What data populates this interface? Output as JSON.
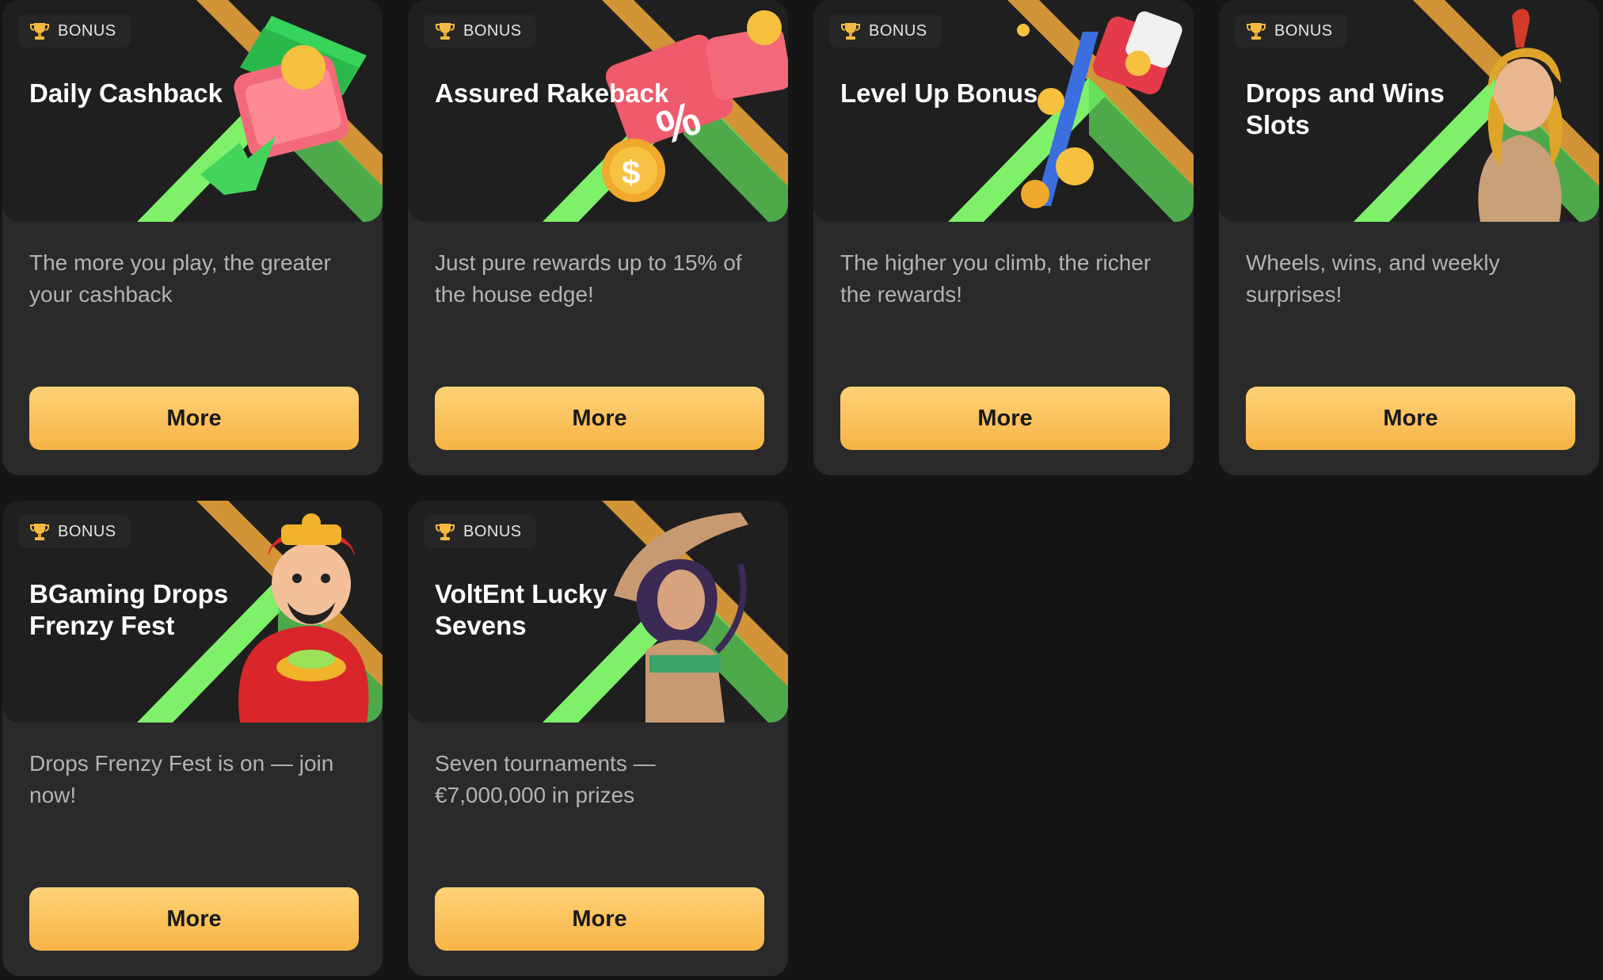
{
  "badge_label": "BONUS",
  "colors": {
    "page_bg": "#151515",
    "card_bg": "#2a2a2a",
    "banner_bg": "#1f1f1f",
    "button_gradient_top": "#ffd277",
    "button_gradient_bottom": "#f6b445",
    "stripe_orange": "#f2a93b",
    "stripe_green": "#7ff06a"
  },
  "cards": [
    {
      "title": "Daily Cashback",
      "description": "The more you play, the greater your cashback",
      "button_label": "More",
      "art_icon": "wallet-cash-icon"
    },
    {
      "title": "Assured Rakeback",
      "description": "Just pure rewards up to 15% of the house edge!",
      "button_label": "More",
      "art_icon": "coupon-coin-icon"
    },
    {
      "title": "Level Up Bonus",
      "description": "The higher you climb, the richer the rewards!",
      "button_label": "More",
      "art_icon": "coin-bucket-icon"
    },
    {
      "title": "Drops and Wins Slots",
      "description": "Wheels, wins, and weekly surprises!",
      "button_label": "More",
      "art_icon": "gladiator-icon"
    },
    {
      "title": "BGaming Drops Frenzy Fest",
      "description": "Drops Frenzy Fest is on — join now!",
      "button_label": "More",
      "art_icon": "fortune-god-icon"
    },
    {
      "title": "VoltEnt Lucky Sevens",
      "description": "Seven tournaments — €7,000,000 in prizes",
      "button_label": "More",
      "art_icon": "dancer-icon"
    }
  ]
}
